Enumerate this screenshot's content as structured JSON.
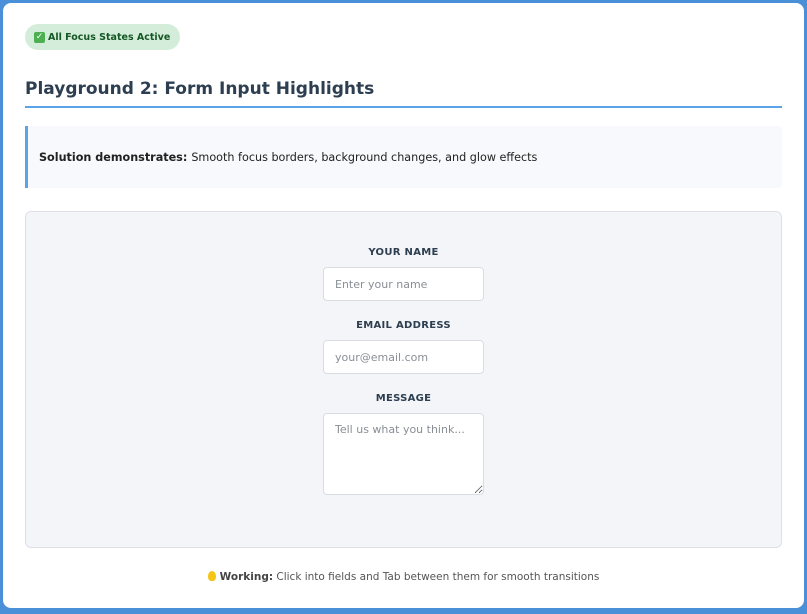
{
  "badge": {
    "icon": "check-mark-icon",
    "text": "All Focus States Active",
    "color": "#d4edda"
  },
  "page_title": "Playground 2: Form Input Highlights",
  "info": {
    "label": "Solution demonstrates:",
    "text": "Smooth focus borders, background changes, and glow effects"
  },
  "form": {
    "name": {
      "label": "YOUR NAME",
      "placeholder": "Enter your name",
      "value": ""
    },
    "email": {
      "label": "EMAIL ADDRESS",
      "placeholder": "your@email.com",
      "value": ""
    },
    "message": {
      "label": "MESSAGE",
      "placeholder": "Tell us what you think...",
      "value": ""
    }
  },
  "footer": {
    "icon": "lightbulb-icon",
    "label": "Working:",
    "text": "Click into fields and Tab between them for smooth transitions"
  },
  "colors": {
    "accent": "#5aa3e6",
    "frame": "#4a90d9",
    "heading": "#2c3e50"
  }
}
